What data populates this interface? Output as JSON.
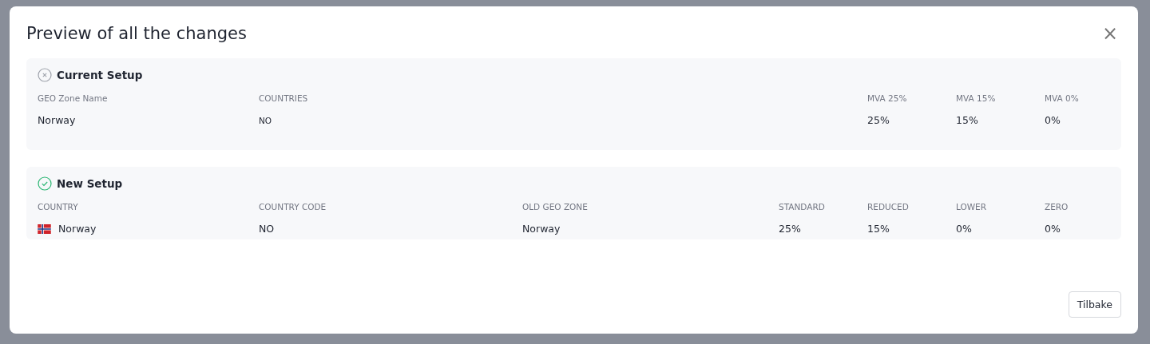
{
  "dialog": {
    "title": "Preview of all the changes",
    "close": "×"
  },
  "sections": [
    {
      "kind": "current",
      "title": "Current Setup",
      "columns": [
        "GEO Zone Name",
        "COUNTRIES",
        "MVA 25%",
        "MVA 15%",
        "MVA 0%"
      ],
      "rows": [
        [
          {
            "text": "Norway"
          },
          {
            "text": "NO",
            "kind": "small"
          },
          {
            "text": "25%"
          },
          {
            "text": "15%"
          },
          {
            "text": "0%"
          }
        ]
      ]
    },
    {
      "kind": "new",
      "title": "New Setup",
      "columns": [
        "COUNTRY",
        "COUNTRY CODE",
        "OLD GEO ZONE",
        "STANDARD",
        "REDUCED",
        "LOWER",
        "ZERO"
      ],
      "rows": [
        [
          {
            "text": "Norway",
            "kind": "country"
          },
          {
            "text": "NO"
          },
          {
            "text": "Norway"
          },
          {
            "text": "25%"
          },
          {
            "text": "15%"
          },
          {
            "text": "0%"
          },
          {
            "text": "0%"
          }
        ]
      ]
    }
  ],
  "buttons": [
    "Tilbake"
  ]
}
